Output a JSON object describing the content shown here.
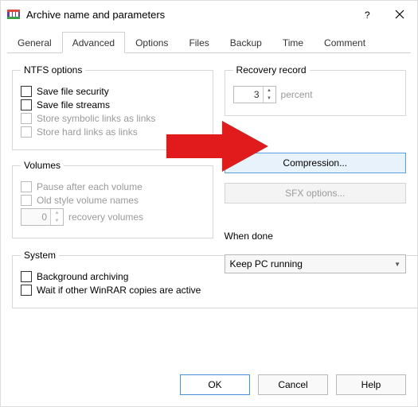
{
  "window": {
    "title": "Archive name and parameters"
  },
  "tabs": [
    "General",
    "Advanced",
    "Options",
    "Files",
    "Backup",
    "Time",
    "Comment"
  ],
  "activeTab": 1,
  "ntfs": {
    "legend": "NTFS options",
    "saveSecurity": "Save file security",
    "saveStreams": "Save file streams",
    "symlinks": "Store symbolic links as links",
    "hardlinks": "Store hard links as links"
  },
  "volumes": {
    "legend": "Volumes",
    "pause": "Pause after each volume",
    "oldstyle": "Old style volume names",
    "spinValue": "0",
    "spinLabel": "recovery volumes"
  },
  "system": {
    "legend": "System",
    "background": "Background archiving",
    "wait": "Wait if other WinRAR copies are active"
  },
  "recovery": {
    "legend": "Recovery record",
    "value": "3",
    "unit": "percent"
  },
  "buttons": {
    "compression": "Compression...",
    "sfx": "SFX options..."
  },
  "whenDone": {
    "label": "When done",
    "value": "Keep PC running"
  },
  "footer": {
    "ok": "OK",
    "cancel": "Cancel",
    "help": "Help"
  }
}
